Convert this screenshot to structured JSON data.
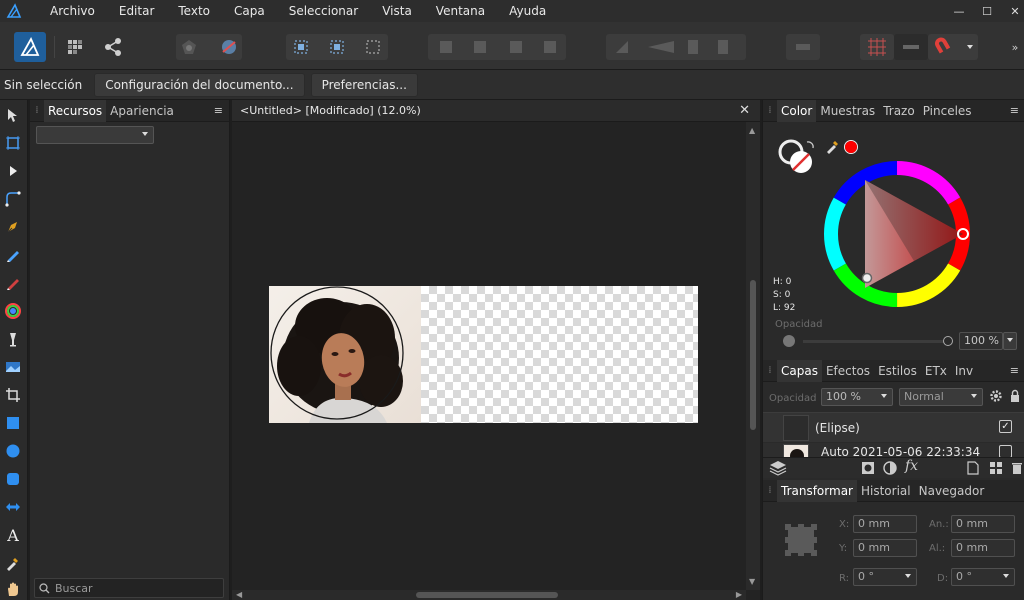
{
  "menu": {
    "items": [
      "Archivo",
      "Editar",
      "Texto",
      "Capa",
      "Seleccionar",
      "Vista",
      "Ventana",
      "Ayuda"
    ]
  },
  "window_controls": {
    "minimize": "—",
    "maximize": "☐",
    "close": "✕"
  },
  "context_bar": {
    "selection_label": "Sin selección",
    "doc_setup_button": "Configuración del documento...",
    "preferences_button": "Preferencias..."
  },
  "left_panel": {
    "tabs": [
      "Recursos",
      "Apariencia"
    ],
    "menu_icon": "≡",
    "search_placeholder": "Buscar"
  },
  "document": {
    "tab_title": "<Untitled> [Modificado] (12.0%)",
    "close_glyph": "✕"
  },
  "color_panel": {
    "tabs": [
      "Color",
      "Muestras",
      "Trazo",
      "Pinceles"
    ],
    "hsl": {
      "h": "H: 0",
      "s": "S: 0",
      "l": "L: 92"
    },
    "opacity_label": "Opacidad",
    "opacity_value": "100 %",
    "accent": "#ff0000"
  },
  "layers_panel": {
    "tabs": [
      "Capas",
      "Efectos",
      "Estilos",
      "ETx",
      "Inv"
    ],
    "opacity_label": "Opacidad",
    "opacity_value": "100 %",
    "blend_mode": "Normal",
    "layers": [
      {
        "name": "(Elipse)",
        "checked": true
      },
      {
        "name": "Auto 2021-05-06 22:33:34",
        "checked": true
      }
    ]
  },
  "transform_panel": {
    "tabs": [
      "Transformar",
      "Historial",
      "Navegador"
    ],
    "x_label": "X:",
    "x_value": "0 mm",
    "y_label": "Y:",
    "y_value": "0 mm",
    "w_label": "An.:",
    "w_value": "0 mm",
    "h_label": "Al.:",
    "h_value": "0 mm",
    "r_label": "R:",
    "r_value": "0 °",
    "s_label": "D:",
    "s_value": "0 °"
  }
}
